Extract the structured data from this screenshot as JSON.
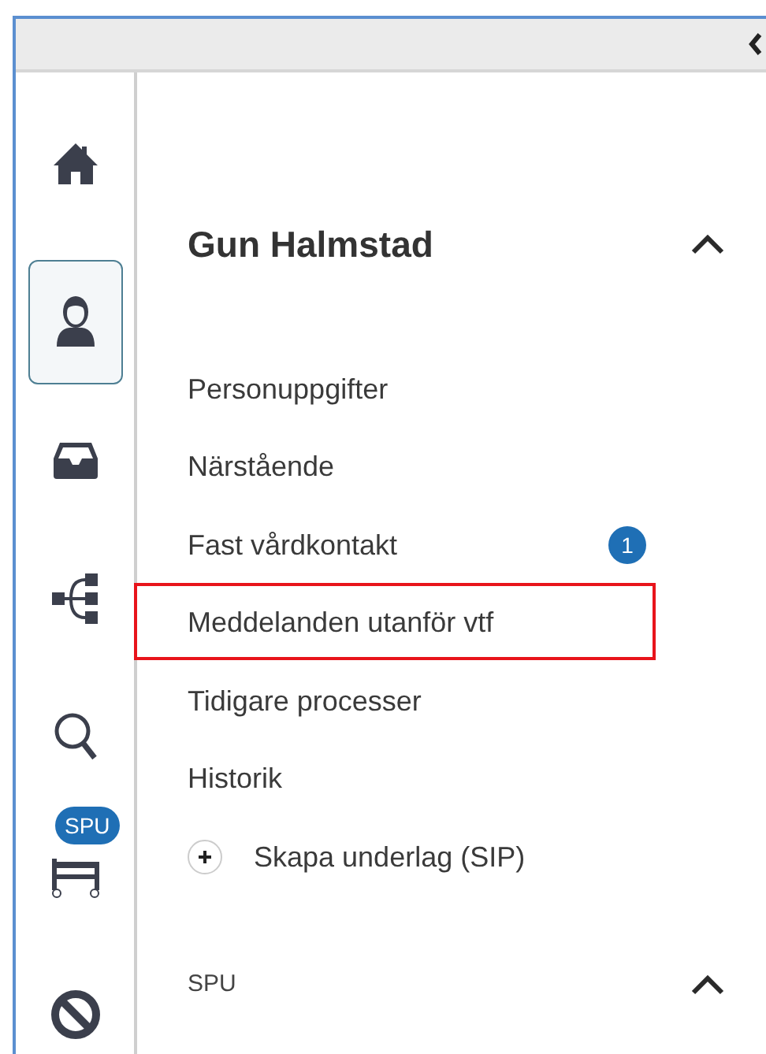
{
  "sidebar": {
    "items": [
      {
        "kind": "home",
        "selected": false
      },
      {
        "kind": "person",
        "selected": true
      },
      {
        "kind": "inbox",
        "selected": false
      },
      {
        "kind": "tree",
        "selected": false
      },
      {
        "kind": "search",
        "selected": false
      },
      {
        "kind": "bed",
        "selected": false,
        "badge": "SPU"
      },
      {
        "kind": "ban",
        "selected": false
      }
    ]
  },
  "sections": [
    {
      "title": "Gun Halmstad",
      "kind": "primary",
      "expanded": true,
      "items": [
        {
          "label": "Personuppgifter",
          "kind": "link",
          "highlighted": false
        },
        {
          "label": "Närstående",
          "kind": "link",
          "highlighted": false
        },
        {
          "label": "Fast vårdkontakt",
          "kind": "link",
          "highlighted": false,
          "badge": "1"
        },
        {
          "label": "Meddelanden utanför vtf",
          "kind": "link",
          "highlighted": true
        },
        {
          "label": "Tidigare processer",
          "kind": "link",
          "highlighted": false
        },
        {
          "label": "Historik",
          "kind": "link",
          "highlighted": false
        },
        {
          "label": "Skapa underlag (SIP)",
          "kind": "action",
          "highlighted": false
        }
      ]
    },
    {
      "title": "SPU",
      "kind": "secondary",
      "expanded": true
    }
  ]
}
